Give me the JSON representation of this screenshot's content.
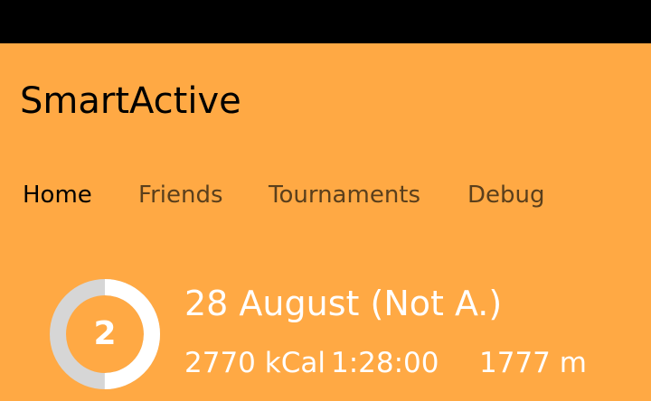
{
  "app": {
    "title": "SmartActive"
  },
  "tabs": [
    {
      "label": "Home",
      "active": true
    },
    {
      "label": "Friends",
      "active": false
    },
    {
      "label": "Tournaments",
      "active": false
    },
    {
      "label": "Debug",
      "active": false
    }
  ],
  "day": {
    "number": "2",
    "title": "28 August (Not A.)",
    "kcal": "2770 kCal",
    "duration": "1:28:00",
    "distance": "1777 m",
    "progress": 0.5
  },
  "colors": {
    "background": "#ffa944",
    "status_bar": "#000000",
    "ring_fill": "#ffffff",
    "ring_track": "#d6d6d6",
    "active_tab": "#000000",
    "inactive_tab": "#5a3f1c"
  }
}
